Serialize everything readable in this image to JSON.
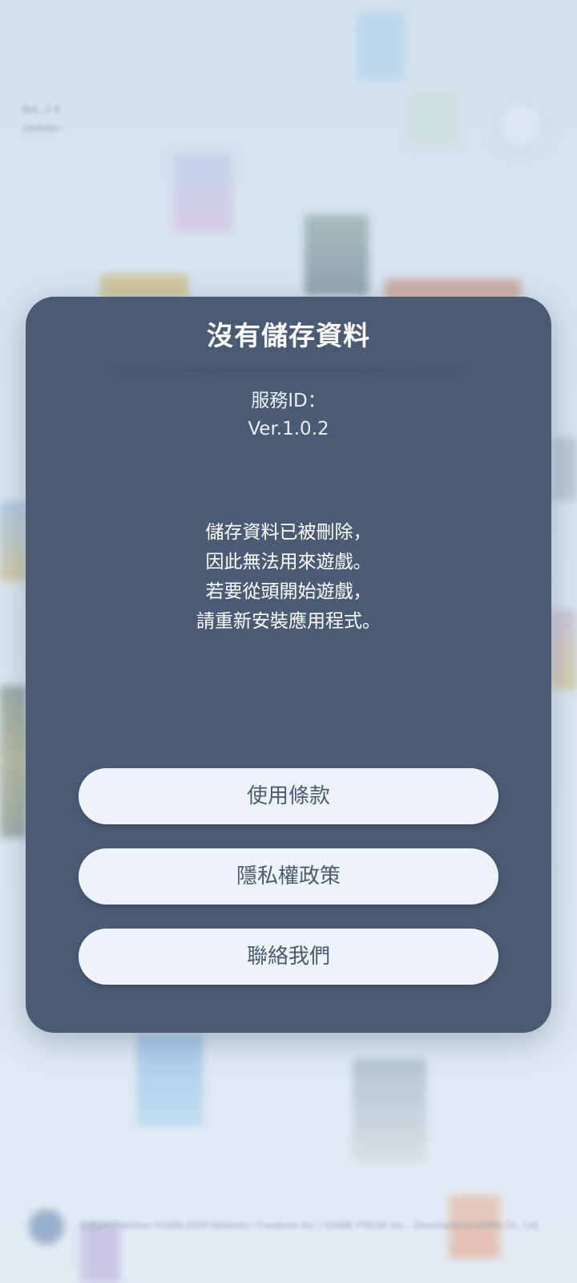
{
  "background": {
    "top_left_text_line1": "Ba...l 4",
    "top_left_text_line2": "Update+",
    "copyright_text": "©2024 Pokémon ©1995-2024 Nintendo / Creatures Inc. / GAME FREAK inc. · Developed by DeNA Co., Ltd."
  },
  "dialog": {
    "title": "沒有儲存資料",
    "service_id": "服務ID：",
    "version": "Ver.1.0.2",
    "message_lines": [
      "儲存資料已被刪除，",
      "因此無法用來遊戲。",
      "若要從頭開始遊戲，",
      "請重新安裝應用程式。"
    ],
    "buttons": {
      "terms": "使用條款",
      "privacy": "隱私權政策",
      "contact": "聯絡我們"
    }
  },
  "colors": {
    "dialog_bg": "#4b5b74",
    "button_bg": "#eef3f9",
    "button_text": "#4b5b74",
    "screen_bg": "#d8e4f1"
  }
}
